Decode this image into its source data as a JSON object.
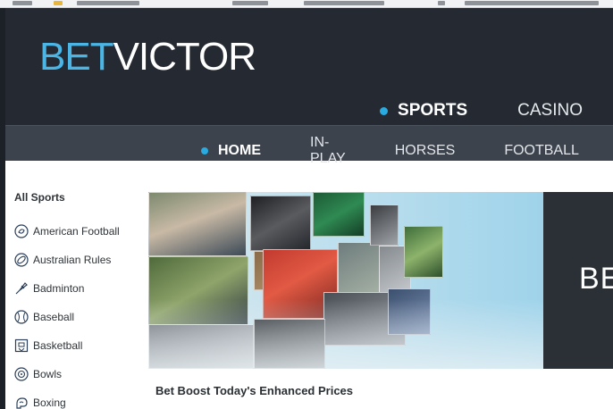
{
  "brand": {
    "logo_part1": "BET",
    "logo_part2": "VICTOR"
  },
  "colors": {
    "accent": "#29aae1",
    "header_bg": "#252a32",
    "subnav_bg": "#3c434c",
    "banner_dark": "#2b3036"
  },
  "top_nav": {
    "sports_label": "SPORTS",
    "casino_label": "CASINO"
  },
  "sub_nav": {
    "home_label": "HOME",
    "inplay_label": "IN-PLAY",
    "horses_label": "HORSES",
    "football_label": "FOOTBALL"
  },
  "sidebar": {
    "title": "All Sports",
    "items": [
      {
        "label": "American Football",
        "icon": "american-football-icon"
      },
      {
        "label": "Australian Rules",
        "icon": "australian-rules-icon"
      },
      {
        "label": "Badminton",
        "icon": "badminton-icon"
      },
      {
        "label": "Baseball",
        "icon": "baseball-icon"
      },
      {
        "label": "Basketball",
        "icon": "basketball-icon"
      },
      {
        "label": "Bowls",
        "icon": "bowls-icon"
      },
      {
        "label": "Boxing",
        "icon": "boxing-icon"
      }
    ]
  },
  "banner": {
    "text": "BE"
  },
  "promo": {
    "heading": "Bet Boost Today's Enhanced Prices"
  }
}
